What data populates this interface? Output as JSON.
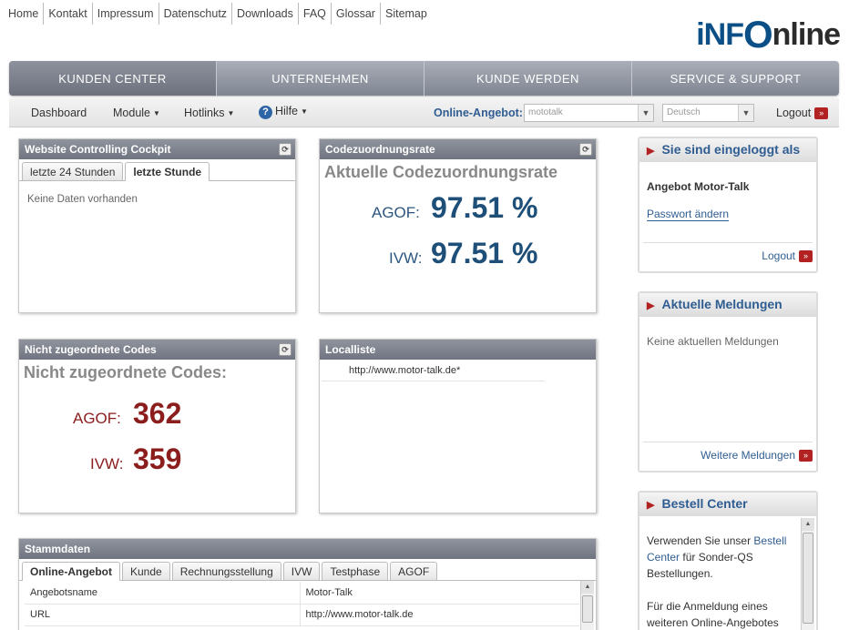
{
  "top_links": [
    "Home",
    "Kontakt",
    "Impressum",
    "Datenschutz",
    "Downloads",
    "FAQ",
    "Glossar",
    "Sitemap"
  ],
  "logo": {
    "part1": "iNF",
    "part2": "O",
    "part3": "nline"
  },
  "main_nav": [
    "KUNDEN CENTER",
    "UNTERNEHMEN",
    "KUNDE WERDEN",
    "SERVICE & SUPPORT"
  ],
  "sub_nav": {
    "dashboard": "Dashboard",
    "module": "Module",
    "hotlinks": "Hotlinks",
    "hilfe": "Hilfe",
    "online_angebot_label": "Online-Angebot:",
    "online_angebot_value": "mototalk",
    "language_value": "Deutsch",
    "logout": "Logout"
  },
  "cockpit": {
    "title": "Website Controlling Cockpit",
    "tabs": [
      "letzte 24 Stunden",
      "letzte Stunde"
    ],
    "empty": "Keine Daten vorhanden"
  },
  "codezuordnung": {
    "title": "Codezuordnungsrate",
    "heading": "Aktuelle Codezuordnungsrate",
    "agof_label": "AGOF:",
    "agof_value": "97.51 %",
    "ivw_label": "IVW:",
    "ivw_value": "97.51 %"
  },
  "nicht_zugeordnet": {
    "title": "Nicht zugeordnete Codes",
    "heading": "Nicht zugeordnete Codes:",
    "agof_label": "AGOF:",
    "agof_value": "362",
    "ivw_label": "IVW:",
    "ivw_value": "359"
  },
  "localliste": {
    "title": "Localliste",
    "items": [
      "http://www.motor-talk.de*"
    ]
  },
  "stammdaten": {
    "title": "Stammdaten",
    "tabs": [
      "Online-Angebot",
      "Kunde",
      "Rechnungsstellung",
      "IVW",
      "Testphase",
      "AGOF"
    ],
    "rows": [
      {
        "key": "Angebotsname",
        "value": "Motor-Talk"
      },
      {
        "key": "URL",
        "value": "http://www.motor-talk.de"
      }
    ]
  },
  "login_box": {
    "title": "Sie sind eingeloggt als",
    "user": "Angebot Motor-Talk",
    "password_link": "Passwort ändern",
    "logout": "Logout"
  },
  "meldungen": {
    "title": "Aktuelle Meldungen",
    "empty": "Keine aktuellen Meldungen",
    "more": "Weitere Meldungen"
  },
  "bestell": {
    "title": "Bestell Center",
    "text1_pre": "Verwenden Sie unser ",
    "text1_link": "Bestell Center",
    "text1_post": " für Sonder-QS Bestellungen.",
    "text2": "Für die Anmeldung eines weiteren Online-Angebotes"
  },
  "colors": {
    "accent_blue": "#1e4f78",
    "accent_red": "#8b1d1d",
    "link_blue": "#2f5d92"
  }
}
